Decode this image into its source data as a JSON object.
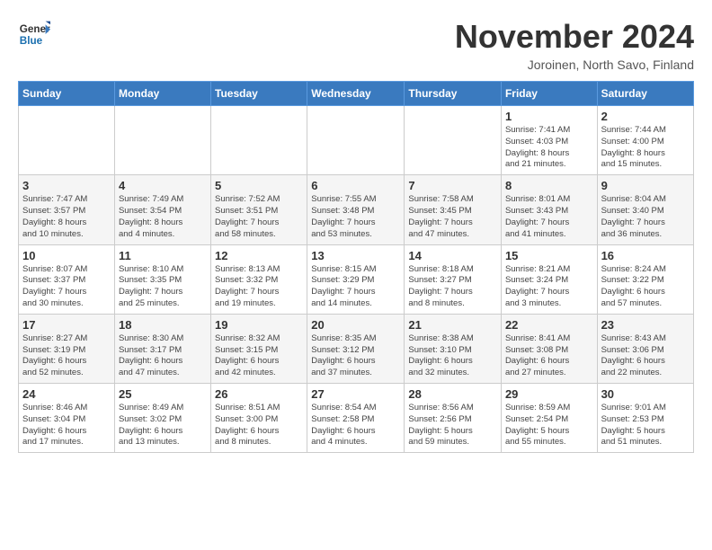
{
  "header": {
    "logo_text_general": "General",
    "logo_text_blue": "Blue",
    "month_title": "November 2024",
    "subtitle": "Joroinen, North Savo, Finland"
  },
  "weekdays": [
    "Sunday",
    "Monday",
    "Tuesday",
    "Wednesday",
    "Thursday",
    "Friday",
    "Saturday"
  ],
  "weeks": [
    [
      {
        "day": "",
        "info": ""
      },
      {
        "day": "",
        "info": ""
      },
      {
        "day": "",
        "info": ""
      },
      {
        "day": "",
        "info": ""
      },
      {
        "day": "",
        "info": ""
      },
      {
        "day": "1",
        "info": "Sunrise: 7:41 AM\nSunset: 4:03 PM\nDaylight: 8 hours\nand 21 minutes."
      },
      {
        "day": "2",
        "info": "Sunrise: 7:44 AM\nSunset: 4:00 PM\nDaylight: 8 hours\nand 15 minutes."
      }
    ],
    [
      {
        "day": "3",
        "info": "Sunrise: 7:47 AM\nSunset: 3:57 PM\nDaylight: 8 hours\nand 10 minutes."
      },
      {
        "day": "4",
        "info": "Sunrise: 7:49 AM\nSunset: 3:54 PM\nDaylight: 8 hours\nand 4 minutes."
      },
      {
        "day": "5",
        "info": "Sunrise: 7:52 AM\nSunset: 3:51 PM\nDaylight: 7 hours\nand 58 minutes."
      },
      {
        "day": "6",
        "info": "Sunrise: 7:55 AM\nSunset: 3:48 PM\nDaylight: 7 hours\nand 53 minutes."
      },
      {
        "day": "7",
        "info": "Sunrise: 7:58 AM\nSunset: 3:45 PM\nDaylight: 7 hours\nand 47 minutes."
      },
      {
        "day": "8",
        "info": "Sunrise: 8:01 AM\nSunset: 3:43 PM\nDaylight: 7 hours\nand 41 minutes."
      },
      {
        "day": "9",
        "info": "Sunrise: 8:04 AM\nSunset: 3:40 PM\nDaylight: 7 hours\nand 36 minutes."
      }
    ],
    [
      {
        "day": "10",
        "info": "Sunrise: 8:07 AM\nSunset: 3:37 PM\nDaylight: 7 hours\nand 30 minutes."
      },
      {
        "day": "11",
        "info": "Sunrise: 8:10 AM\nSunset: 3:35 PM\nDaylight: 7 hours\nand 25 minutes."
      },
      {
        "day": "12",
        "info": "Sunrise: 8:13 AM\nSunset: 3:32 PM\nDaylight: 7 hours\nand 19 minutes."
      },
      {
        "day": "13",
        "info": "Sunrise: 8:15 AM\nSunset: 3:29 PM\nDaylight: 7 hours\nand 14 minutes."
      },
      {
        "day": "14",
        "info": "Sunrise: 8:18 AM\nSunset: 3:27 PM\nDaylight: 7 hours\nand 8 minutes."
      },
      {
        "day": "15",
        "info": "Sunrise: 8:21 AM\nSunset: 3:24 PM\nDaylight: 7 hours\nand 3 minutes."
      },
      {
        "day": "16",
        "info": "Sunrise: 8:24 AM\nSunset: 3:22 PM\nDaylight: 6 hours\nand 57 minutes."
      }
    ],
    [
      {
        "day": "17",
        "info": "Sunrise: 8:27 AM\nSunset: 3:19 PM\nDaylight: 6 hours\nand 52 minutes."
      },
      {
        "day": "18",
        "info": "Sunrise: 8:30 AM\nSunset: 3:17 PM\nDaylight: 6 hours\nand 47 minutes."
      },
      {
        "day": "19",
        "info": "Sunrise: 8:32 AM\nSunset: 3:15 PM\nDaylight: 6 hours\nand 42 minutes."
      },
      {
        "day": "20",
        "info": "Sunrise: 8:35 AM\nSunset: 3:12 PM\nDaylight: 6 hours\nand 37 minutes."
      },
      {
        "day": "21",
        "info": "Sunrise: 8:38 AM\nSunset: 3:10 PM\nDaylight: 6 hours\nand 32 minutes."
      },
      {
        "day": "22",
        "info": "Sunrise: 8:41 AM\nSunset: 3:08 PM\nDaylight: 6 hours\nand 27 minutes."
      },
      {
        "day": "23",
        "info": "Sunrise: 8:43 AM\nSunset: 3:06 PM\nDaylight: 6 hours\nand 22 minutes."
      }
    ],
    [
      {
        "day": "24",
        "info": "Sunrise: 8:46 AM\nSunset: 3:04 PM\nDaylight: 6 hours\nand 17 minutes."
      },
      {
        "day": "25",
        "info": "Sunrise: 8:49 AM\nSunset: 3:02 PM\nDaylight: 6 hours\nand 13 minutes."
      },
      {
        "day": "26",
        "info": "Sunrise: 8:51 AM\nSunset: 3:00 PM\nDaylight: 6 hours\nand 8 minutes."
      },
      {
        "day": "27",
        "info": "Sunrise: 8:54 AM\nSunset: 2:58 PM\nDaylight: 6 hours\nand 4 minutes."
      },
      {
        "day": "28",
        "info": "Sunrise: 8:56 AM\nSunset: 2:56 PM\nDaylight: 5 hours\nand 59 minutes."
      },
      {
        "day": "29",
        "info": "Sunrise: 8:59 AM\nSunset: 2:54 PM\nDaylight: 5 hours\nand 55 minutes."
      },
      {
        "day": "30",
        "info": "Sunrise: 9:01 AM\nSunset: 2:53 PM\nDaylight: 5 hours\nand 51 minutes."
      }
    ]
  ]
}
